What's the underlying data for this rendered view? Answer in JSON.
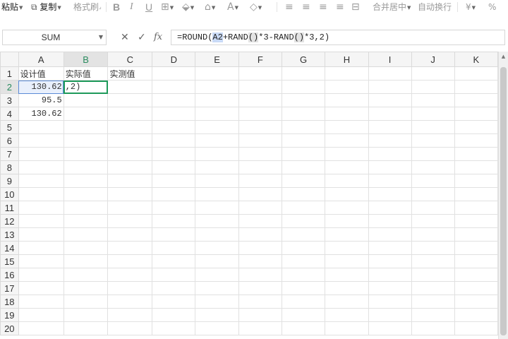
{
  "toolbar": {
    "paste": "粘贴",
    "copy": "复制",
    "format_painter": "格式刷",
    "bold": "B",
    "italic": "I",
    "underline": "U",
    "merge_center": "合并居中",
    "wrap_text": "自动换行",
    "currency": "¥",
    "percent": "%"
  },
  "formula_bar": {
    "name_box": "SUM",
    "cancel": "✕",
    "confirm": "✓",
    "fx": "fx",
    "formula_prefix": "=ROUND(",
    "formula_ref": "A2",
    "formula_mid1": "+RAND",
    "formula_paren1": "()",
    "formula_mid2": "*3-RAND",
    "formula_paren2": "()",
    "formula_suffix": "*3,2)"
  },
  "sheet": {
    "columns": [
      "A",
      "B",
      "C",
      "D",
      "E",
      "F",
      "G",
      "H",
      "I",
      "J",
      "K"
    ],
    "rows": [
      "1",
      "2",
      "3",
      "4",
      "5",
      "6",
      "7",
      "8",
      "9",
      "10",
      "11",
      "12",
      "13",
      "14",
      "15",
      "16",
      "17",
      "18",
      "19",
      "20"
    ],
    "cells": {
      "A1": "设计值",
      "B1": "实际值",
      "C1": "实测值",
      "A2": "130.62",
      "A3": "95.5",
      "A4": "130.62",
      "B2": ",2)"
    },
    "active_cell": "B2"
  }
}
